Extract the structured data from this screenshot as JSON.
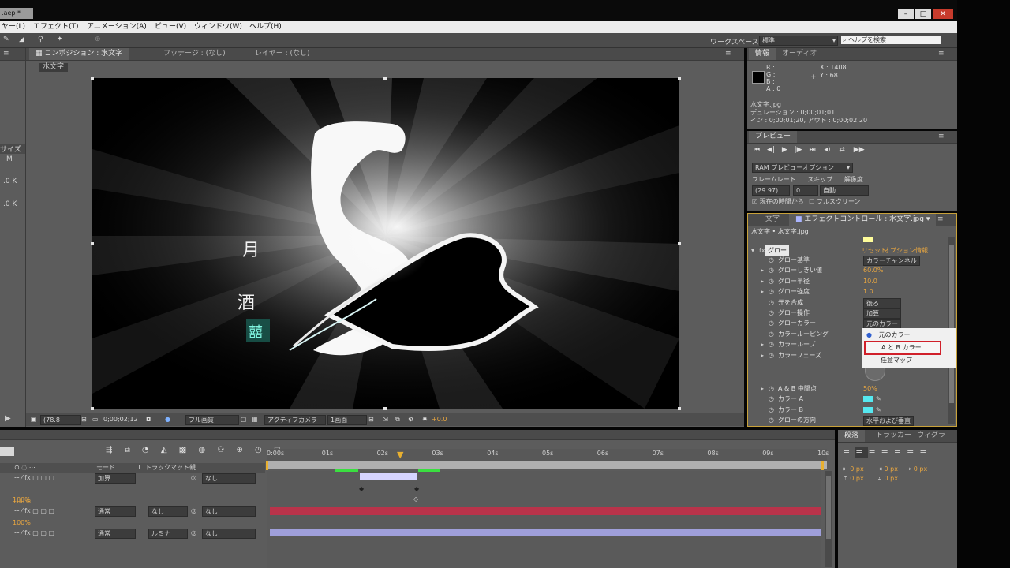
{
  "titlebar": {
    "file_tab": ".aep *",
    "win_buttons": [
      "–",
      "□",
      "✕"
    ]
  },
  "menubar": [
    "ヤー(L)",
    "エフェクト(T)",
    "アニメーション(A)",
    "ビュー(V)",
    "ウィンドウ(W)",
    "ヘルプ(H)"
  ],
  "toolbar": {
    "workspace_label": "ワークスペース :",
    "workspace_value": "標準",
    "help_search_placeholder": "ヘルプを検索"
  },
  "left_strip": {
    "label_size": "サイズ",
    "values": [
      "M",
      ".0 K",
      ".0 K"
    ]
  },
  "comp_panel": {
    "tabs": [
      "コンポジション : 水文字",
      "フッテージ : (なし)",
      "レイヤー : (なし)"
    ],
    "breadcrumb": "水文字",
    "footer": {
      "zoom": "(78.8",
      "timecode": "0;00;02;12",
      "resolution": "フル画質",
      "camera": "アクティブカメラ",
      "view": "1画面",
      "exposure": "+0.0"
    }
  },
  "info_panel": {
    "tabs": [
      "情報",
      "オーディオ"
    ],
    "rgba_labels": [
      "R :",
      "G :",
      "B :",
      "A : 0"
    ],
    "coords": [
      "X : 1408",
      "Y : 681"
    ],
    "file_name": "水文字.jpg",
    "duration": "デュレーション : 0;00;01;01",
    "in_out": "イン : 0;00;01;20, アウト : 0;00;02;20"
  },
  "preview_panel": {
    "tab": "プレビュー",
    "ram_option": "RAM プレビューオプション",
    "labels": [
      "フレームレート",
      "スキップ",
      "解像度"
    ],
    "fps": "(29.97)",
    "skip": "0",
    "resolution": "自動",
    "from_current": "現在の時間から",
    "fullscreen": "フルスクリーン"
  },
  "effects_panel": {
    "tabs": [
      "文字",
      "エフェクトコントロール : 水文字.jpg"
    ],
    "path": "水文字 • 水文字.jpg",
    "effect_name": "グロー",
    "effect_links": [
      "リセット",
      "オプション...",
      "情報..."
    ],
    "properties": [
      {
        "name": "グロー基準",
        "value": "カラーチャンネル",
        "type": "dropdown"
      },
      {
        "name": "グローしきい値",
        "value": "60.0%",
        "type": "orange"
      },
      {
        "name": "グロー半径",
        "value": "10.0",
        "type": "orange"
      },
      {
        "name": "グロー強度",
        "value": "1.0",
        "type": "orange"
      },
      {
        "name": "元を合成",
        "value": "後ろ",
        "type": "dropdown"
      },
      {
        "name": "グロー操作",
        "value": "加算",
        "type": "dropdown"
      },
      {
        "name": "グローカラー",
        "value": "元のカラー",
        "type": "dropdown"
      },
      {
        "name": "カラールーピング",
        "value": "",
        "type": "none"
      },
      {
        "name": "カラーループ",
        "value": "",
        "type": "none"
      },
      {
        "name": "カラーフェーズ",
        "value": "",
        "type": "none"
      }
    ],
    "props_lower": [
      {
        "name": "A & B 中間点",
        "value": "50%",
        "type": "orange"
      },
      {
        "name": "カラー A",
        "value": "",
        "type": "swatch"
      },
      {
        "name": "カラー B",
        "value": "",
        "type": "swatch"
      },
      {
        "name": "グローの方向",
        "value": "水平および垂直",
        "type": "dropdown"
      }
    ],
    "popup_options": [
      "元のカラー",
      "A と B カラー",
      "任意マップ"
    ],
    "popup_selected": 0,
    "popup_highlight": 1
  },
  "timeline": {
    "ruler_labels": [
      "0:00s",
      "01s",
      "02s",
      "03s",
      "04s",
      "05s",
      "06s",
      "07s",
      "08s",
      "09s",
      "10s"
    ],
    "header_labels": [
      "モード",
      "T",
      "トラックマット",
      "親"
    ],
    "layers": [
      {
        "mode": "加算",
        "trkmat": "",
        "parent": "なし",
        "opacity": ""
      },
      {
        "mode": "通常",
        "trkmat": "なし",
        "parent": "なし",
        "opacity": "100%"
      },
      {
        "mode": "通常",
        "trkmat": "ルミナ",
        "parent": "なし",
        "opacity": "100%"
      }
    ],
    "extra_opacity": "100%"
  },
  "paragraph_panel": {
    "tabs": [
      "段落",
      "トラッカー",
      "ウィグラ"
    ],
    "px_values": [
      "0 px",
      "0 px",
      "0 px",
      "0 px",
      "0 px"
    ]
  },
  "colors": {
    "panel": "#5c5c5c",
    "track_red": "#b9334a",
    "track_blue": "#9f9fda",
    "playhead": "#e03030",
    "highlight_red": "#d0202a",
    "swatch_cyan": "#56e8f0",
    "swatch_yellow": "#fffd9a"
  }
}
